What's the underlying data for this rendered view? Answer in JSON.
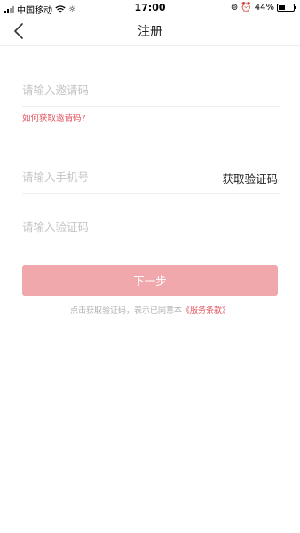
{
  "status_bar": {
    "carrier": "中国移动",
    "time": "17:00",
    "battery": "44%",
    "battery_level": 0.44
  },
  "nav": {
    "title": "注册"
  },
  "form": {
    "invite_placeholder": "请输入邀请码",
    "invite_help": "如何获取邀请码?",
    "phone_placeholder": "请输入手机号",
    "get_code": "获取验证码",
    "code_placeholder": "请输入验证码",
    "next": "下一步"
  },
  "agreement": {
    "text": "点击获取验证码，表示已同意本",
    "terms": "《服务条款》"
  },
  "colors": {
    "accent": "#e0535e",
    "button_bg": "#f1a8ad"
  }
}
